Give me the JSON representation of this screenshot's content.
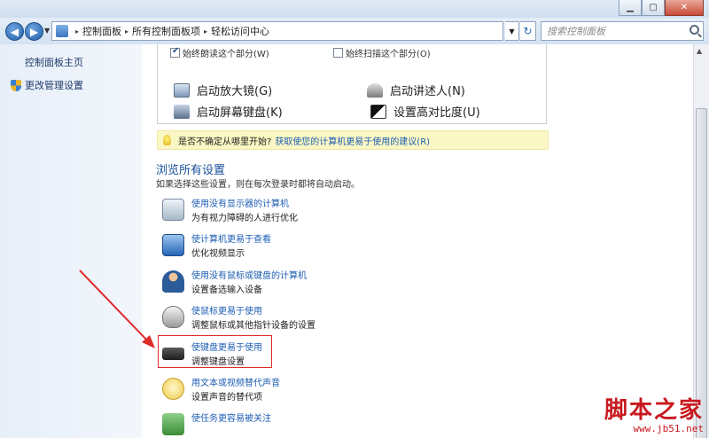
{
  "window": {
    "minimize_glyph": "▁",
    "maximize_glyph": "▢",
    "close_glyph": "✕"
  },
  "address_bar": {
    "back_glyph": "◀",
    "forward_glyph": "▶",
    "history_glyph": "▼",
    "crumbs": [
      "控制面板",
      "所有控制面板项",
      "轻松访问中心"
    ],
    "separator": "▸",
    "dropdown_glyph": "▼",
    "refresh_glyph": "↻",
    "search_placeholder": "搜索控制面板"
  },
  "left_pane": {
    "home_link": "控制面板主页",
    "admin_link": "更改管理设置",
    "admin_icon": "shield-icon"
  },
  "main": {
    "checkbox_read": {
      "label": "始终朗读这个部分(W)",
      "checked": true
    },
    "checkbox_scan": {
      "label": "始终扫描这个部分(O)",
      "checked": false
    },
    "tools": [
      {
        "label": "启动放大镜(G)",
        "icon": "magnifier-icon"
      },
      {
        "label": "启动讲述人(N)",
        "icon": "narrator-icon"
      },
      {
        "label": "启动屏幕键盘(K)",
        "icon": "keyboard-icon"
      },
      {
        "label": "设置高对比度(U)",
        "icon": "contrast-icon"
      }
    ],
    "tip": {
      "question": "是否不确定从哪里开始?",
      "link": "获取使您的计算机更易于使用的建议(R)"
    },
    "section_title": "浏览所有设置",
    "section_desc": "如果选择这些设置，则在每次登录时都将自动启动。",
    "settings": [
      {
        "title": "使用没有显示器的计算机",
        "sub": "为有视力障碍的人进行优化",
        "icon": "monitor-icon"
      },
      {
        "title": "使计算机更易于查看",
        "sub": "优化视频显示",
        "icon": "screen-icon"
      },
      {
        "title": "使用没有鼠标或键盘的计算机",
        "sub": "设置备选输入设备",
        "icon": "person-icon"
      },
      {
        "title": "使鼠标更易于使用",
        "sub": "调整鼠标或其他指针设备的设置",
        "icon": "mouse-icon"
      },
      {
        "title": "使键盘更易于使用",
        "sub": "调整键盘设置",
        "icon": "keyboard-icon"
      },
      {
        "title": "用文本或视频替代声音",
        "sub": "设置声音的替代项",
        "icon": "speech-icon"
      },
      {
        "title": "使任务更容易被关注",
        "sub": "",
        "icon": "tasks-icon"
      }
    ]
  },
  "annotation": {
    "highlight_color": "#e02b2b"
  },
  "watermark": {
    "main": "脚本之家",
    "url": "www.jb51.net"
  }
}
